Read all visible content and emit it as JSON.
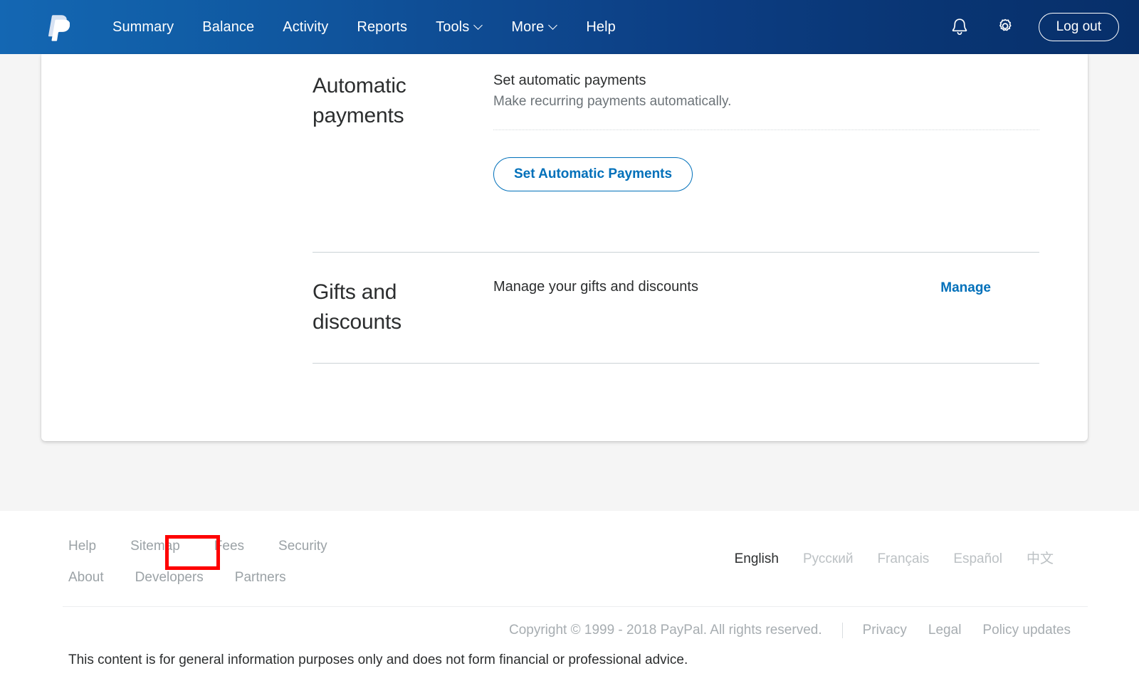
{
  "header": {
    "logo_name": "paypal-logo",
    "nav": [
      {
        "label": "Summary",
        "has_dropdown": false
      },
      {
        "label": "Balance",
        "has_dropdown": false
      },
      {
        "label": "Activity",
        "has_dropdown": false
      },
      {
        "label": "Reports",
        "has_dropdown": false
      },
      {
        "label": "Tools",
        "has_dropdown": true
      },
      {
        "label": "More",
        "has_dropdown": true
      },
      {
        "label": "Help",
        "has_dropdown": false
      }
    ],
    "notifications_icon": "bell-icon",
    "settings_icon": "gear-icon",
    "logout_label": "Log out",
    "gradient_start": "#1467b3",
    "gradient_end": "#072f6a"
  },
  "main": {
    "sections": [
      {
        "label": "Automatic payments",
        "title": "Set automatic payments",
        "subtitle": "Make recurring payments automatically.",
        "button_label": "Set Automatic Payments"
      },
      {
        "label": "Gifts and discounts",
        "title": "Manage your gifts and discounts",
        "action_label": "Manage"
      }
    ],
    "accent_color": "#0070ba"
  },
  "footer": {
    "links_row1": [
      "Help",
      "Sitemap",
      "Fees",
      "Security"
    ],
    "links_row2": [
      "About",
      "Developers",
      "Partners"
    ],
    "languages": [
      "English",
      "Русский",
      "Français",
      "Español",
      "中文"
    ],
    "active_language": "English",
    "copyright": "Copyright © 1999 - 2018 PayPal. All rights reserved.",
    "legal_links": [
      "Privacy",
      "Legal",
      "Policy updates"
    ],
    "disclaimer": "This content is for general information purposes only and does not form financial or professional advice."
  },
  "annotation": {
    "highlight_target": "Fees",
    "highlight_color": "#fe0000"
  }
}
